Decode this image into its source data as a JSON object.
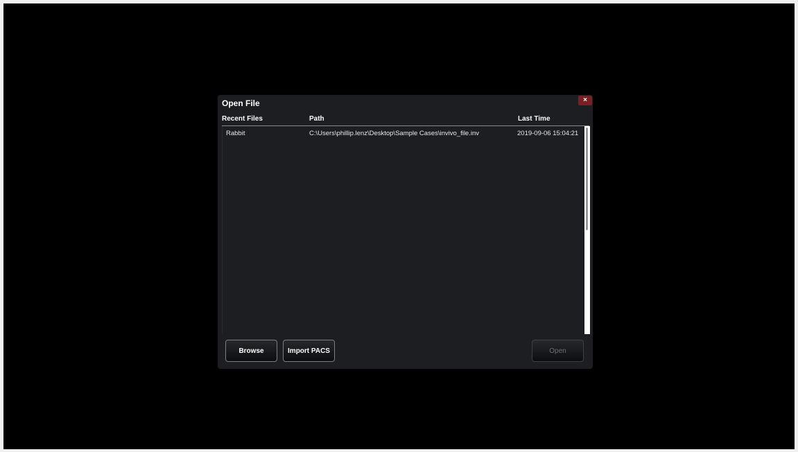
{
  "dialog": {
    "title": "Open File",
    "close_label": "×"
  },
  "table": {
    "headers": {
      "name": "Recent Files",
      "path": "Path",
      "time": "Last Time"
    },
    "rows": [
      {
        "name": "Rabbit",
        "path": "C:\\Users\\phillip.lenz\\Desktop\\Sample Cases\\invivo_file.inv",
        "time": "2019-09-06 15:04:21"
      }
    ]
  },
  "buttons": {
    "browse": "Browse",
    "import_pacs": "Import PACS",
    "open": "Open"
  },
  "colors": {
    "background": "#000000",
    "dialog": "#1c1e22",
    "close": "#7a1f24"
  }
}
